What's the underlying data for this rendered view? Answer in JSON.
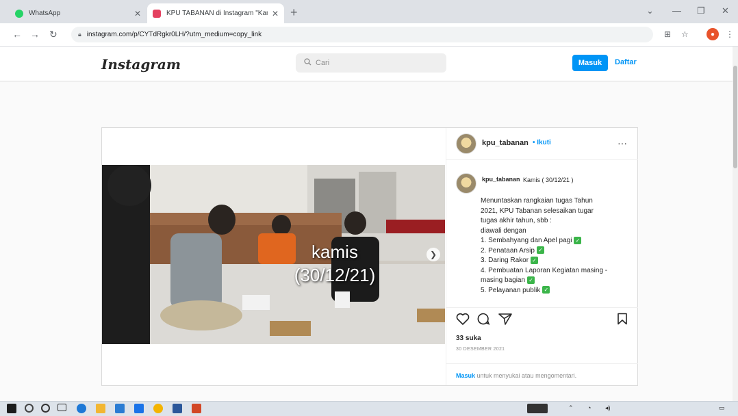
{
  "browser": {
    "tabs": [
      {
        "label": "WhatsApp",
        "active": false,
        "favicon_color": "#25d366"
      },
      {
        "label": "KPU TABANAN di Instagram \"Kam",
        "active": true,
        "favicon_color": "#e4405f"
      }
    ],
    "new_tab": "+",
    "address": "instagram.com/p/CYTdRgkr0LH/?utm_medium=copy_link"
  },
  "instagram": {
    "logo": "Instagram",
    "search_placeholder": "Cari",
    "login_label": "Masuk",
    "signup_label": "Daftar"
  },
  "post": {
    "username": "kpu_tabanan",
    "follow_label": "• Ikuti",
    "overlay_day": "kamis",
    "overlay_date": "(30/12/21)",
    "caption_header": "Kamis ( 30/12/21 )",
    "caption_lines": [
      {
        "text": "Menuntaskan rangkaian tugas Tahun",
        "check": false
      },
      {
        "text": "2021, KPU Tabanan selesaikan tugar",
        "check": false
      },
      {
        "text": "tugas akhir tahun, sbb :",
        "check": false
      },
      {
        "text": "diawali dengan",
        "check": false
      },
      {
        "text": "1. Sembahyang dan Apel pagi",
        "check": true
      },
      {
        "text": "2. Penataan Arsip",
        "check": true
      },
      {
        "text": "3. Daring Rakor",
        "check": true
      },
      {
        "text": "4. Pembuatan Laporan Kegiatan masing -",
        "check": false
      },
      {
        "text": "masing bagian",
        "check": true
      },
      {
        "text": "5. Pelayanan publik",
        "check": true
      }
    ],
    "likes": "33 suka",
    "date": "30 DESEMBER 2021",
    "login_note_link": "Masuk",
    "login_note_rest": " untuk menyukai atau mengomentari."
  },
  "icons": [
    "heart-icon",
    "comment-icon",
    "share-icon",
    "bookmark-icon",
    "more-icon",
    "search-icon",
    "lock-icon"
  ],
  "colors": {
    "accent": "#0095f6",
    "check": "#3bb54a"
  }
}
